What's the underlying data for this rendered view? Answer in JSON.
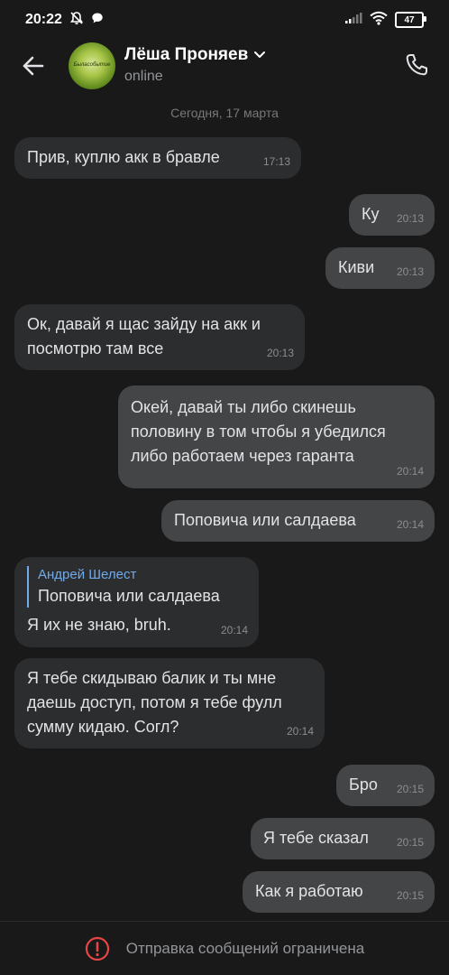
{
  "status_bar": {
    "time": "20:22",
    "battery": "47"
  },
  "header": {
    "contact_name": "Лёша Проняев",
    "contact_status": "online",
    "avatar_text": "Быласобытие"
  },
  "date_separator": "Сегодня, 17 марта",
  "messages": [
    {
      "direction": "in",
      "text": "Прив, куплю акк в бравле",
      "time": "17:13"
    },
    {
      "direction": "out",
      "text": "Ку",
      "time": "20:13"
    },
    {
      "direction": "out",
      "text": "Киви",
      "time": "20:13"
    },
    {
      "direction": "in",
      "text": "Ок, давай я щас зайду на акк и\nпосмотрю там все",
      "time": "20:13"
    },
    {
      "direction": "out",
      "text": "Окей, давай ты либо скинешь\nполовину в том чтобы я убедился\nлибо работаем через гаранта",
      "time": "20:14"
    },
    {
      "direction": "out",
      "text": "Поповича или салдаева",
      "time": "20:14"
    },
    {
      "direction": "in",
      "reply_author": "Андрей Шелест",
      "reply_text": "Поповича или салдаева",
      "text": "Я их не знаю, bruh.",
      "time": "20:14"
    },
    {
      "direction": "in",
      "text": "Я тебе скидываю балик и ты мне\nдаешь доступ, потом я тебе фулл\nсумму кидаю. Согл?",
      "time": "20:14"
    },
    {
      "direction": "out",
      "text": "Бро",
      "time": "20:15"
    },
    {
      "direction": "out",
      "text": "Я тебе сказал",
      "time": "20:15"
    },
    {
      "direction": "out",
      "text": "Как я работаю",
      "time": "20:15"
    }
  ],
  "bottom_bar": {
    "text": "Отправка сообщений ограничена"
  },
  "colors": {
    "background": "#19191a",
    "bubble_in": "#2c2d2e",
    "bubble_out": "#444547",
    "reply_accent": "#71aaeb",
    "warning": "#e64646"
  },
  "icons": [
    "mute-icon",
    "chat-icon",
    "signal-icon",
    "wifi-icon",
    "battery-icon",
    "back-arrow-icon",
    "chevron-down-icon",
    "phone-icon",
    "warning-icon"
  ]
}
